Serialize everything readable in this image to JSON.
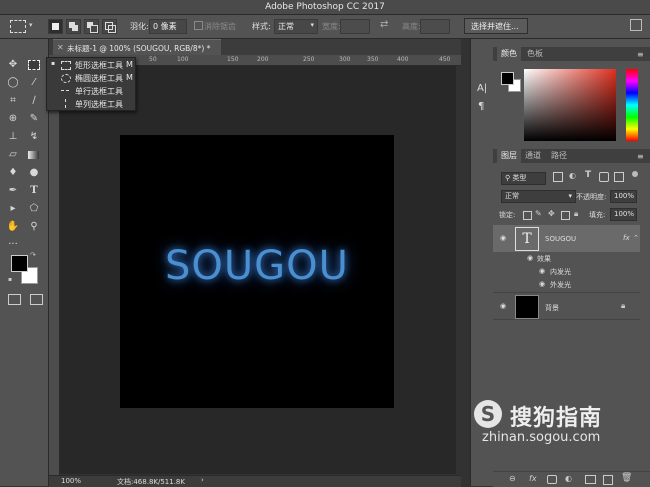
{
  "window": {
    "title": "Adobe Photoshop CC 2017"
  },
  "options_bar": {
    "feather_label": "羽化:",
    "feather_value": "0 像素",
    "antialias_label": "消除锯齿",
    "style_label": "样式:",
    "style_value": "正常",
    "width_label": "宽度:",
    "height_label": "高度:",
    "select_mask_button": "选择并遮住..."
  },
  "document": {
    "tab_title": "未标题-1 @ 100% (SOUGOU, RGB/8*) *",
    "canvas_text": "SOUGOU",
    "ruler_numbers": [
      "50",
      "100",
      "150",
      "200",
      "250",
      "300",
      "350",
      "400",
      "450"
    ]
  },
  "status_bar": {
    "zoom": "100%",
    "doc_info": "文档:468.8K/511.8K"
  },
  "flyout": {
    "items": [
      {
        "label": "矩形选框工具",
        "key": "M"
      },
      {
        "label": "椭圆选框工具",
        "key": "M"
      },
      {
        "label": "单行选框工具",
        "key": ""
      },
      {
        "label": "单列选框工具",
        "key": ""
      }
    ]
  },
  "color_panel": {
    "tabs": [
      "颜色",
      "色板"
    ]
  },
  "layers_panel": {
    "tabs": [
      "图层",
      "通道",
      "路径"
    ],
    "filter_label": "类型",
    "blend_mode": "正常",
    "opacity_label": "不透明度:",
    "opacity_value": "100%",
    "lock_label": "锁定:",
    "fill_label": "填充:",
    "fill_value": "100%",
    "layers": [
      {
        "name": "SOUGOU",
        "fx": "fx"
      },
      {
        "name": "背景"
      }
    ],
    "effects_label": "效果",
    "effects": [
      "内发光",
      "外发光"
    ],
    "bottom_fx": "fx"
  },
  "watermark": {
    "brand": "搜狗指南",
    "url": "zhinan.sogou.com"
  },
  "colors": {
    "glow_text": "#4a8fd0",
    "foreground": "#000000",
    "background": "#ffffff",
    "selected_layer": "#6a6a6a"
  }
}
